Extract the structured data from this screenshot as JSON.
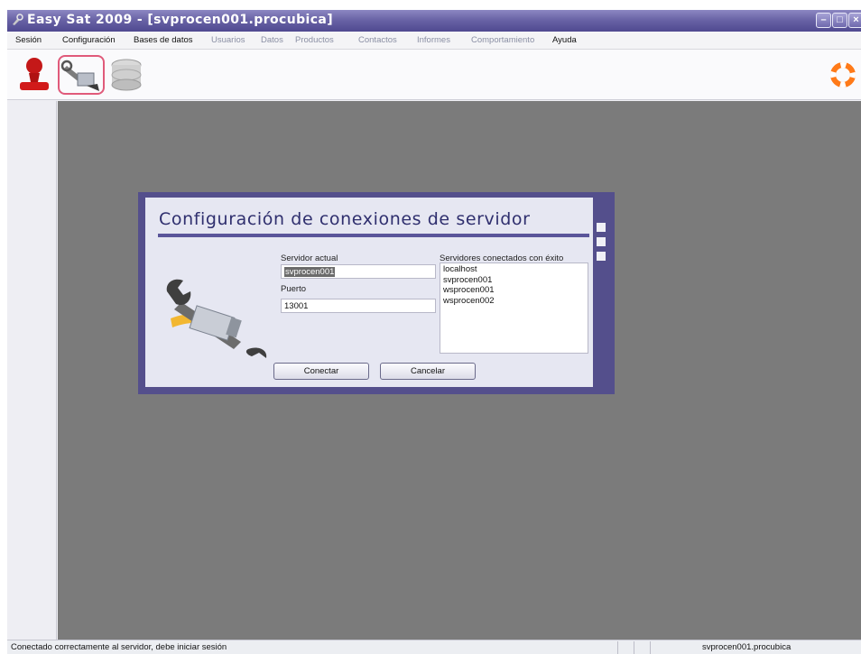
{
  "window": {
    "title": "Easy Sat 2009 - [svprocen001.procubica]",
    "controls": [
      "minimize",
      "maximize",
      "close"
    ]
  },
  "menu": {
    "items": [
      {
        "label": "Sesión",
        "enabled": true
      },
      {
        "label": "Configuración",
        "enabled": true
      },
      {
        "label": "Bases de datos",
        "enabled": true
      },
      {
        "label": "Usuarios",
        "enabled": false
      },
      {
        "label": "Datos",
        "enabled": false
      },
      {
        "label": "Productos",
        "enabled": false
      },
      {
        "label": "Contactos",
        "enabled": false
      },
      {
        "label": "Informes",
        "enabled": false
      },
      {
        "label": "Comportamiento",
        "enabled": false
      },
      {
        "label": "Ayuda",
        "enabled": true
      }
    ]
  },
  "toolbar": {
    "buttons": [
      {
        "icon": "user-stamp-icon",
        "active": false
      },
      {
        "icon": "config-tools-icon",
        "active": true
      },
      {
        "icon": "database-icon",
        "active": false
      }
    ],
    "help_icon": "lifebuoy-icon"
  },
  "dialog": {
    "title": "Configuración de conexiones de servidor",
    "server_label": "Servidor actual",
    "server_value": "svprocen001",
    "port_label": "Puerto",
    "port_value": "13001",
    "connected_label": "Servidores conectados con éxito",
    "connected_servers": [
      "localhost",
      "svprocen001",
      "wsprocen001",
      "wsprocen002"
    ],
    "connect_label": "Conectar",
    "cancel_label": "Cancelar"
  },
  "status": {
    "message": "Conectado correctamente al servidor, debe iniciar sesión",
    "server": "svprocen001.procubica"
  },
  "colors": {
    "title_bar": "#6a64a6",
    "dialog_frame": "#544f8c",
    "desktop": "#7b7b7b"
  }
}
